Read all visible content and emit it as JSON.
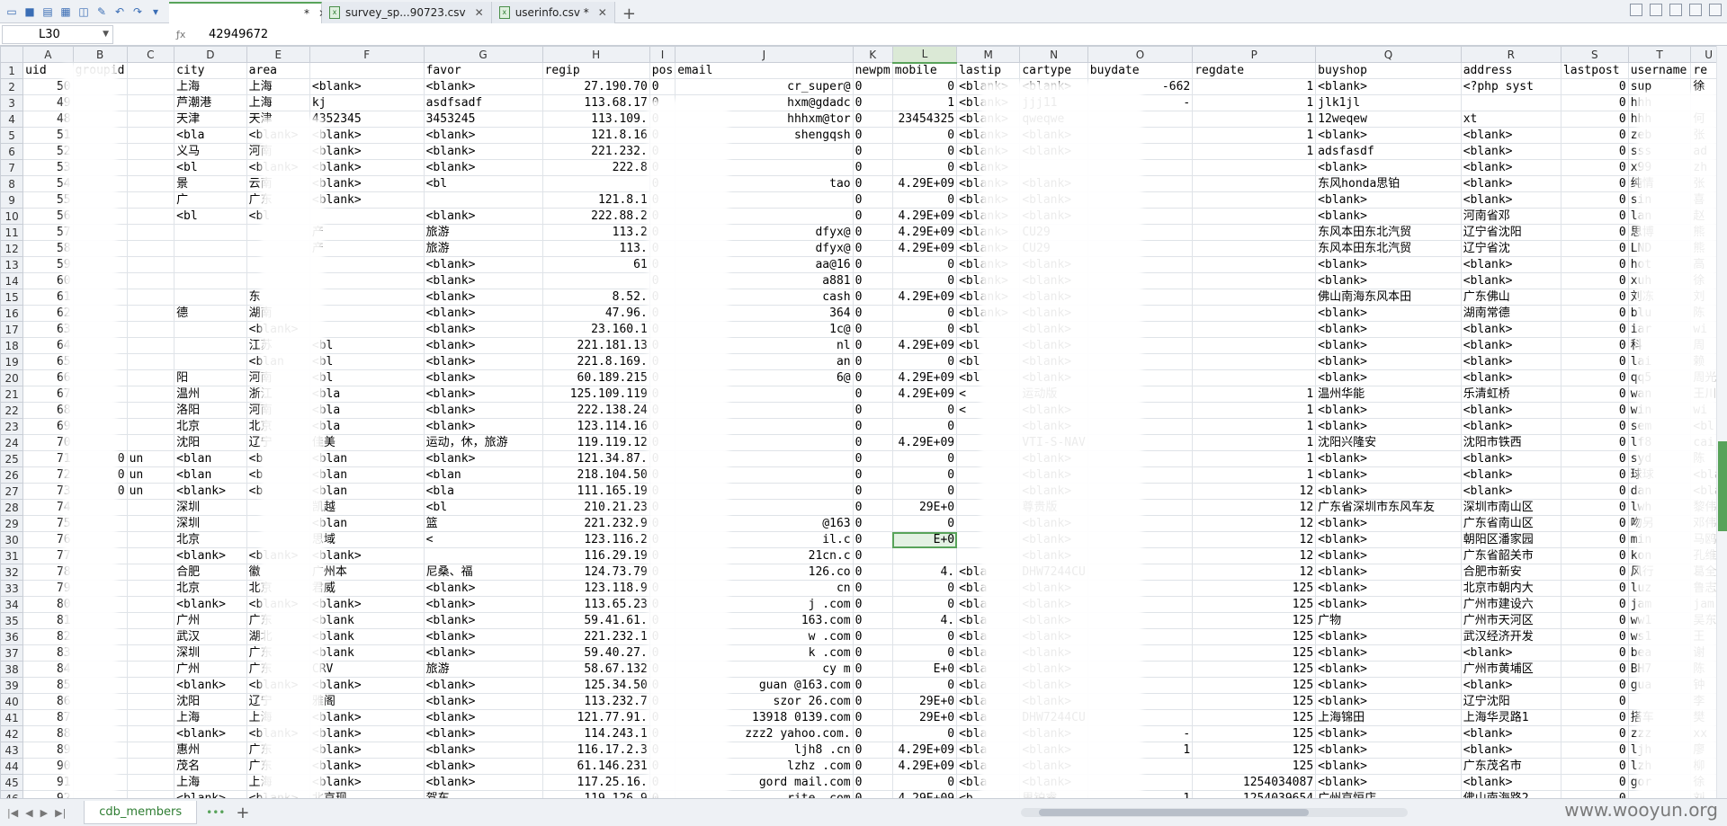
{
  "tabs": [
    {
      "label": "*",
      "icon": "spreadsheet-icon",
      "active": true
    },
    {
      "label": "survey_sp...90723.csv",
      "icon": "spreadsheet-icon",
      "active": false
    },
    {
      "label": "userinfo.csv *",
      "icon": "spreadsheet-icon",
      "active": false
    }
  ],
  "formula_bar": {
    "name_box": "L30",
    "value": "42949672"
  },
  "columns": [
    "A",
    "B",
    "C",
    "D",
    "E",
    "F",
    "G",
    "H",
    "I",
    "J",
    "K",
    "L",
    "M",
    "N",
    "O",
    "P",
    "Q",
    "R",
    "S",
    "T",
    "U"
  ],
  "selected_column": "L",
  "header_row": [
    "uid",
    "groupid",
    "",
    "city",
    "area",
    "",
    "favor",
    "regip",
    "pos",
    "email",
    "newpm",
    "mobile",
    "lastip",
    "cartype",
    "buydate",
    "regdate",
    "buyshop",
    "address",
    "lastpost",
    "username",
    "re"
  ],
  "rows": [
    {
      "rh": "2",
      "cells": [
        "50",
        "",
        "",
        "上海",
        "上海",
        "<blank>",
        "<blank>",
        "27.190.70",
        "0",
        "cr_super@",
        "0",
        "0",
        "<blank>",
        "<blank>",
        "-662",
        "1",
        "<blank>",
        "<?php syst",
        "0",
        "sup",
        "徐"
      ]
    },
    {
      "rh": "3",
      "cells": [
        "49",
        "",
        "",
        "芦潮港",
        "上海",
        "kj",
        "asdfsadf",
        "113.68.17",
        "0",
        "hxm@gdadc",
        "0",
        "1",
        "<blank>",
        "jjj11",
        "-",
        "1",
        "jlk1jl",
        "",
        "0",
        "hhh",
        ""
      ]
    },
    {
      "rh": "4",
      "cells": [
        "48",
        "",
        "",
        "天津",
        "天津",
        "4352345",
        "3453245",
        "113.109.",
        "0",
        "hhhxm@tor",
        "0",
        "23454325",
        "<blank>",
        "qweqwe",
        "",
        "1",
        "12weqew",
        "xt",
        "0",
        "hhh",
        "何"
      ]
    },
    {
      "rh": "5",
      "cells": [
        "51",
        "",
        "",
        "<bla",
        "<blank>",
        "<blank>",
        "<blank>",
        "121.8.16",
        "0",
        "shengqsh",
        "0",
        "0",
        "<blank>",
        "<blank>",
        "",
        "1",
        "<blank>",
        "<blank>",
        "0",
        "zeb",
        "张"
      ]
    },
    {
      "rh": "6",
      "cells": [
        "52",
        "",
        "",
        "义马",
        "河南",
        "<blank>",
        "<blank>",
        "221.232.",
        "0",
        "",
        "0",
        "0",
        "<blank>",
        "<blank>",
        "",
        "1",
        "adsfasdf",
        "<blank>",
        "0",
        "sss",
        "ad"
      ]
    },
    {
      "rh": "7",
      "cells": [
        "53",
        "",
        "",
        "<bl",
        "<blank>",
        "<blank>",
        "<blank>",
        "222.8",
        "0",
        "",
        "0",
        "0",
        "<blank>",
        "",
        "",
        "",
        "<blank>",
        "<blank>",
        "0",
        "x99",
        "zh"
      ]
    },
    {
      "rh": "8",
      "cells": [
        "54",
        "",
        "",
        "景",
        "云南",
        "<blank>",
        "<bl",
        "",
        "0",
        "tao",
        "0",
        "4.29E+09",
        "<blank>",
        "<blank>",
        "",
        "",
        "东风honda思铂",
        "<blank>",
        "0",
        "纯情",
        "张"
      ]
    },
    {
      "rh": "9",
      "cells": [
        "55",
        "",
        "",
        "广",
        "广东",
        "<blank>",
        "",
        "121.8.1",
        "0",
        "",
        "0",
        "0",
        "<blank>",
        "<blank>",
        "",
        "",
        "<blank>",
        "<blank>",
        "0",
        "sin",
        "喜"
      ]
    },
    {
      "rh": "10",
      "cells": [
        "56",
        "",
        "",
        "<bl",
        "<bl",
        "",
        "<blank>",
        "222.88.2",
        "0",
        "",
        "0",
        "4.29E+09",
        "<blank>",
        "<blank>",
        "",
        "",
        "<blank>",
        "河南省邓",
        "0",
        "lan",
        "赵"
      ]
    },
    {
      "rh": "11",
      "cells": [
        "57",
        "",
        "",
        "",
        "",
        "产",
        "旅游",
        "113.2",
        "0",
        "dfyx@",
        "0",
        "4.29E+09",
        "<blank>",
        "CU29",
        "",
        "",
        "东风本田东北汽贸",
        "辽宁省沈阳",
        "0",
        "思博",
        "熊"
      ]
    },
    {
      "rh": "12",
      "cells": [
        "58",
        "",
        "",
        "",
        "",
        "产",
        "旅游",
        "113.",
        "0",
        "dfyx@",
        "0",
        "4.29E+09",
        "<blank>",
        "CU29",
        "",
        "",
        "东风本田东北汽贸",
        "辽宁省沈",
        "0",
        "LND",
        "熊"
      ]
    },
    {
      "rh": "13",
      "cells": [
        "59",
        "",
        "",
        "",
        "",
        "",
        "<blank>",
        "61",
        "0",
        "aa@16",
        "0",
        "0",
        "<blank>",
        "<blank>",
        "",
        "",
        "<blank>",
        "<blank>",
        "0",
        "hot",
        "高"
      ]
    },
    {
      "rh": "14",
      "cells": [
        "60",
        "",
        "",
        "",
        "",
        "",
        "<blank>",
        "",
        "0",
        "a881",
        "0",
        "0",
        "<blank>",
        "<blank>",
        "",
        "",
        "<blank>",
        "<blank>",
        "0",
        "xuh",
        "徐"
      ]
    },
    {
      "rh": "15",
      "cells": [
        "61",
        "",
        "",
        "",
        "东",
        "",
        "<blank>",
        "8.52.",
        "0",
        "cash",
        "0",
        "4.29E+09",
        "<blank>",
        "<blank>",
        "",
        "",
        "佛山南海东风本田",
        "广东佛山",
        "0",
        "刘冻",
        "刘"
      ]
    },
    {
      "rh": "16",
      "cells": [
        "62",
        "",
        "",
        "德",
        "湖南",
        "",
        "<blank>",
        "47.96.",
        "0",
        "364",
        "0",
        "0",
        "<blank>",
        "<blank>",
        "",
        "",
        "<blank>",
        "湖南常德",
        "0",
        "blu",
        "陈"
      ]
    },
    {
      "rh": "17",
      "cells": [
        "63",
        "",
        "",
        "",
        "<blank>",
        "",
        "<blank>",
        "23.160.1",
        "0",
        "1c@",
        "0",
        "0",
        "<bl",
        "<blank>",
        "",
        "",
        "<blank>",
        "<blank>",
        "0",
        "iar",
        "wi"
      ]
    },
    {
      "rh": "18",
      "cells": [
        "64",
        "",
        "",
        "",
        "江苏",
        "<bl",
        "<blank>",
        "221.181.13",
        "0",
        "nl",
        "0",
        "4.29E+09",
        "<bl",
        "<blank>",
        "",
        "",
        "<blank>",
        "<blank>",
        "0",
        "科",
        "周"
      ]
    },
    {
      "rh": "19",
      "cells": [
        "65",
        "",
        "",
        "",
        "<blan",
        "<bl",
        "<blank>",
        "221.8.169.",
        "0",
        "an",
        "0",
        "0",
        "<bl",
        "<blank>",
        "",
        "",
        "<blank>",
        "<blank>",
        "0",
        "lai",
        "赖"
      ]
    },
    {
      "rh": "20",
      "cells": [
        "66",
        "",
        "",
        "阳",
        "河南",
        "<bl",
        "<blank>",
        "60.189.215",
        "0",
        "6@",
        "0",
        "4.29E+09",
        "<bl",
        "<blank>",
        "",
        "",
        "<blank>",
        "<blank>",
        "0",
        "qq5",
        "周光"
      ]
    },
    {
      "rh": "21",
      "cells": [
        "67",
        "",
        "",
        "温州",
        "浙江",
        "<bla",
        "<blank>",
        "125.109.119",
        "0",
        "",
        "0",
        "4.29E+09",
        "<",
        "运动版",
        "",
        "1",
        "温州华能",
        "乐清虹桥",
        "0",
        "wan",
        "王川"
      ]
    },
    {
      "rh": "22",
      "cells": [
        "68",
        "",
        "",
        "洛阳",
        "河南",
        "<bla",
        "<blank>",
        "222.138.24",
        "0",
        "",
        "0",
        "0",
        "<",
        "<blank>",
        "",
        "1",
        "<blank>",
        "<blank>",
        "0",
        "win",
        "wi"
      ]
    },
    {
      "rh": "23",
      "cells": [
        "69",
        "",
        "",
        "北京",
        "北京",
        "<bla",
        "<blank>",
        "123.114.16",
        "0",
        "",
        "0",
        "0",
        "",
        "<blank>",
        "",
        "1",
        "<blank>",
        "<blank>",
        "0",
        "sem",
        "<bl"
      ]
    },
    {
      "rh": "24",
      "cells": [
        "70",
        "",
        "",
        "沈阳",
        "辽宁",
        "佳美",
        "运动，休，旅游",
        "119.119.12",
        "0",
        "",
        "0",
        "4.29E+09",
        "",
        "VTI-S-NAV",
        "",
        "1",
        "沈阳兴隆安",
        "沈阳市铁西",
        "0",
        "lf8",
        "cai"
      ]
    },
    {
      "rh": "25",
      "cells": [
        "71",
        "0",
        "un",
        "<blan",
        "<b",
        "<blan",
        "<blank>",
        "121.34.87.",
        "0",
        "",
        "0",
        "0",
        "",
        "<blank>",
        "",
        "1",
        "<blank>",
        "<blank>",
        "0",
        "syd",
        "陈"
      ]
    },
    {
      "rh": "26",
      "cells": [
        "72",
        "0",
        "un",
        "<blan",
        "<b",
        "<blan",
        "<blan",
        "218.104.50",
        "0",
        "",
        "0",
        "0",
        "",
        "<blank>",
        "",
        "1",
        "<blank>",
        "<blank>",
        "0",
        "球球",
        "<bla"
      ]
    },
    {
      "rh": "27",
      "cells": [
        "73",
        "0",
        "un",
        "<blank>",
        "<b",
        "<blan",
        "<bla",
        "111.165.19",
        "0",
        "",
        "0",
        "0",
        "",
        "<blank>",
        "",
        "12",
        "<blank>",
        "<blank>",
        "0",
        "dan",
        "<bla"
      ]
    },
    {
      "rh": "28",
      "cells": [
        "74",
        "",
        "",
        "深圳",
        "",
        "凯越",
        "<bl",
        "210.21.23",
        "0",
        "",
        "0",
        "29E+0",
        "",
        "尊贵版",
        "",
        "12",
        "广东省深圳市东风车友",
        "深圳市南山区",
        "0",
        "lwh",
        "黎伟"
      ]
    },
    {
      "rh": "29",
      "cells": [
        "75",
        "",
        "",
        "深圳",
        "",
        "<blan",
        "篮",
        "221.232.9",
        "0",
        "@163",
        "0",
        "0",
        "",
        "<blank>",
        "",
        "12",
        "<blank>",
        "广东省南山区",
        "0",
        "吻另",
        "邓伟"
      ]
    },
    {
      "rh": "30",
      "cells": [
        "76",
        "",
        "",
        "北京",
        "",
        "思域",
        "<",
        "123.116.2",
        "0",
        "il.c",
        "0",
        "E+0",
        "",
        "<blank>",
        "",
        "12",
        "<blank>",
        "朝阳区潘家园",
        "0",
        "min",
        "马鸥"
      ]
    },
    {
      "rh": "31",
      "cells": [
        "77",
        "",
        "",
        "<blank>",
        "<blank>",
        "<blank>",
        "",
        "116.29.19",
        "0",
        "21cn.c",
        "0",
        "",
        "",
        "<blank>",
        "",
        "12",
        "<blank>",
        "广东省韶关市",
        "0",
        "kon",
        "孔维"
      ]
    },
    {
      "rh": "32",
      "cells": [
        "78",
        "",
        "",
        "合肥",
        "徽",
        "广州本",
        "尼桑、福",
        "124.73.79",
        "0",
        "126.co",
        "0",
        "4.",
        "<bla",
        "DHW7244CU",
        "",
        "12",
        "<blank>",
        "合肥市新安",
        "0",
        "风行",
        "葛全"
      ]
    },
    {
      "rh": "33",
      "cells": [
        "79",
        "",
        "",
        "北京",
        "北京",
        "君威",
        "<blank>",
        "123.118.9",
        "0",
        "cn",
        "0",
        "0",
        "<bla",
        "<blank>",
        "",
        "125",
        "<blank>",
        "北京市朝内大",
        "0",
        "luz",
        "鲁志"
      ]
    },
    {
      "rh": "34",
      "cells": [
        "80",
        "",
        "",
        "<blank>",
        "<blank>",
        "<blank>",
        "<blank>",
        "113.65.23",
        "0",
        "j .com",
        "0",
        "0",
        "<bla",
        "<blank>",
        "",
        "125",
        "<blank>",
        "广州市建设六",
        "0",
        "jam",
        "jam"
      ]
    },
    {
      "rh": "35",
      "cells": [
        "81",
        "",
        "",
        "广州",
        "广东",
        "<blank",
        "<blank>",
        "59.41.61.",
        "0",
        "163.com",
        "0",
        "4.",
        "<bla",
        "<blank>",
        "",
        "125",
        "广物",
        "广州市天河区",
        "0",
        "ww1",
        "吴东"
      ]
    },
    {
      "rh": "36",
      "cells": [
        "82",
        "",
        "",
        "武汉",
        "湖北",
        "<blank",
        "<blank>",
        "221.232.1",
        "0",
        "w .com",
        "0",
        "0",
        "<bla",
        "<blank>",
        "",
        "125",
        "<blank>",
        "武汉经济开发",
        "0",
        "ws1",
        "王"
      ]
    },
    {
      "rh": "37",
      "cells": [
        "83",
        "",
        "",
        "深圳",
        "广东",
        "<blank",
        "<blank>",
        "59.40.27.",
        "0",
        "k .com",
        "0",
        "0",
        "<bla",
        "<blank>",
        "",
        "125",
        "<blank>",
        "<blank>",
        "0",
        "bea",
        "谢"
      ]
    },
    {
      "rh": "38",
      "cells": [
        "84",
        "",
        "",
        "广州",
        "广东",
        "CRV",
        "旅游",
        "58.67.132",
        "0",
        "cy m",
        "0",
        "E+0",
        "<bla",
        "<blank>",
        "",
        "125",
        "<blank>",
        "广州市黄埔区",
        "0",
        "BH7",
        "陈"
      ]
    },
    {
      "rh": "39",
      "cells": [
        "85",
        "",
        "",
        "<blank>",
        "<blank>",
        "<blank>",
        "<blank>",
        "125.34.50",
        "0",
        "guan @163.com",
        "0",
        "0",
        "<bla",
        "<blank>",
        "",
        "125",
        "<blank>",
        "<blank>",
        "0",
        "gua",
        "钟"
      ]
    },
    {
      "rh": "40",
      "cells": [
        "86",
        "",
        "",
        "沈阳",
        "辽宁",
        "雅阁",
        "<blank>",
        "113.232.7",
        "0",
        "szor 26.com",
        "0",
        "29E+0",
        "<bla",
        "<blank>",
        "",
        "125",
        "<blank>",
        "辽宁沈阳",
        "0",
        "",
        "李"
      ]
    },
    {
      "rh": "41",
      "cells": [
        "87",
        "",
        "",
        "上海",
        "上海",
        "<blank>",
        "<blank>",
        "121.77.91.",
        "0",
        "13918 0139.com",
        "0",
        "29E+0",
        "<bla",
        "DHW7244CU",
        "",
        "125",
        "上海锦田",
        "上海华灵路1",
        "0",
        "搭车",
        "樊"
      ]
    },
    {
      "rh": "42",
      "cells": [
        "88",
        "",
        "",
        "<blank>",
        "<blank>",
        "<blank>",
        "<blank>",
        "114.243.1",
        "0",
        "zzz2 yahoo.com.",
        "0",
        "0",
        "<bla",
        "<blank>",
        "-",
        "125",
        "<blank>",
        "<blank>",
        "0",
        "zzz",
        "xx"
      ]
    },
    {
      "rh": "43",
      "cells": [
        "89",
        "",
        "",
        "惠州",
        "广东",
        "<blank>",
        "<blank>",
        "116.17.2.3",
        "0",
        "ljh8 .cn",
        "0",
        "4.29E+09",
        "<bla",
        "<blank>",
        "1",
        "125",
        "<blank>",
        "<blank>",
        "0",
        "ljh",
        "廖"
      ]
    },
    {
      "rh": "44",
      "cells": [
        "90",
        "",
        "",
        "茂名",
        "广东",
        "<blank>",
        "<blank>",
        "61.146.231",
        "0",
        "lzhz .com",
        "0",
        "4.29E+09",
        "<bla",
        "<blank>",
        "",
        "125",
        "<blank>",
        "广东茂名市",
        "0",
        "lzh",
        "柳"
      ]
    },
    {
      "rh": "45",
      "cells": [
        "91",
        "",
        "",
        "上海",
        "上海",
        "<blank>",
        "<blank>",
        "117.25.16.",
        "0",
        "gord mail.com",
        "0",
        "0",
        "<bla",
        "<blank>",
        "",
        "1254034087",
        "<blank>",
        "<blank>",
        "0",
        "gor",
        "徐"
      ]
    },
    {
      "rh": "46",
      "cells": [
        "92",
        "",
        "",
        "<blank>",
        "<blank>",
        "北京现",
        "驾车",
        "119.126.9",
        "0",
        "rite .com",
        "0",
        "4.29E+09",
        "<b",
        "思铂睿",
        "1",
        "1254039654",
        "广州京恒店",
        "佛山南海路2",
        "0",
        "",
        "刘"
      ]
    }
  ],
  "sheet": {
    "name": "cdb_members"
  },
  "watermark": "www.wooyun.org",
  "colors": {
    "accent": "#58a35a",
    "header_bg": "#eef1f5"
  }
}
